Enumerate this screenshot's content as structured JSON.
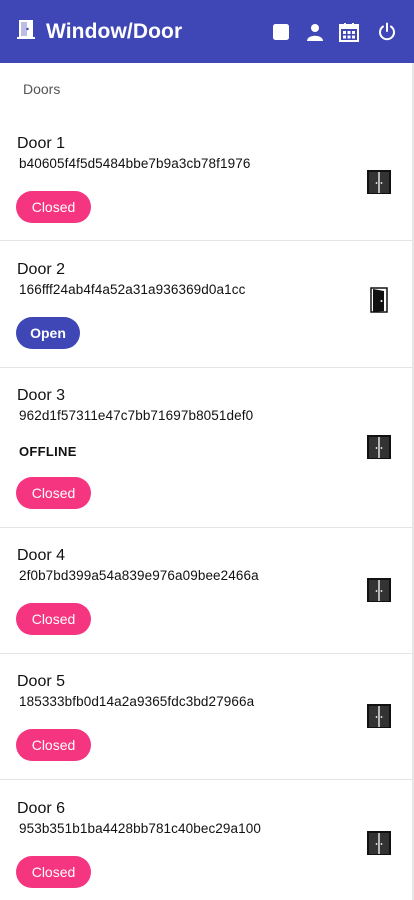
{
  "app": {
    "title": "Window/Door",
    "brand_color": "#3f46b5",
    "accent_color": "#f5357f"
  },
  "header": {
    "actions": [
      {
        "icon": "stop-square-icon"
      },
      {
        "icon": "user-icon"
      },
      {
        "icon": "calendar-icon"
      },
      {
        "icon": "power-icon"
      }
    ]
  },
  "section": {
    "label": "Doors"
  },
  "doors": [
    {
      "name": "Door 1",
      "id": "b40605f4f5d5484bbe7b9a3cb78f1976",
      "state": "Closed",
      "icon": "double-door-closed-icon"
    },
    {
      "name": "Door 2",
      "id": "166fff24ab4f4a52a31a936369d0a1cc",
      "state": "Open",
      "icon": "door-open-icon"
    },
    {
      "name": "Door 3",
      "id": "962d1f57311e47c7bb71697b8051def0",
      "status": "OFFLINE",
      "state": "Closed",
      "icon": "double-door-closed-icon"
    },
    {
      "name": "Door 4",
      "id": "2f0b7bd399a54a839e976a09bee2466a",
      "state": "Closed",
      "icon": "double-door-closed-icon"
    },
    {
      "name": "Door 5",
      "id": "185333bfb0d14a2a9365fdc3bd27966a",
      "state": "Closed",
      "icon": "double-door-closed-icon"
    },
    {
      "name": "Door 6",
      "id": "953b351b1ba4428bb781c40bec29a100",
      "state": "Closed",
      "icon": "double-door-closed-icon"
    }
  ]
}
